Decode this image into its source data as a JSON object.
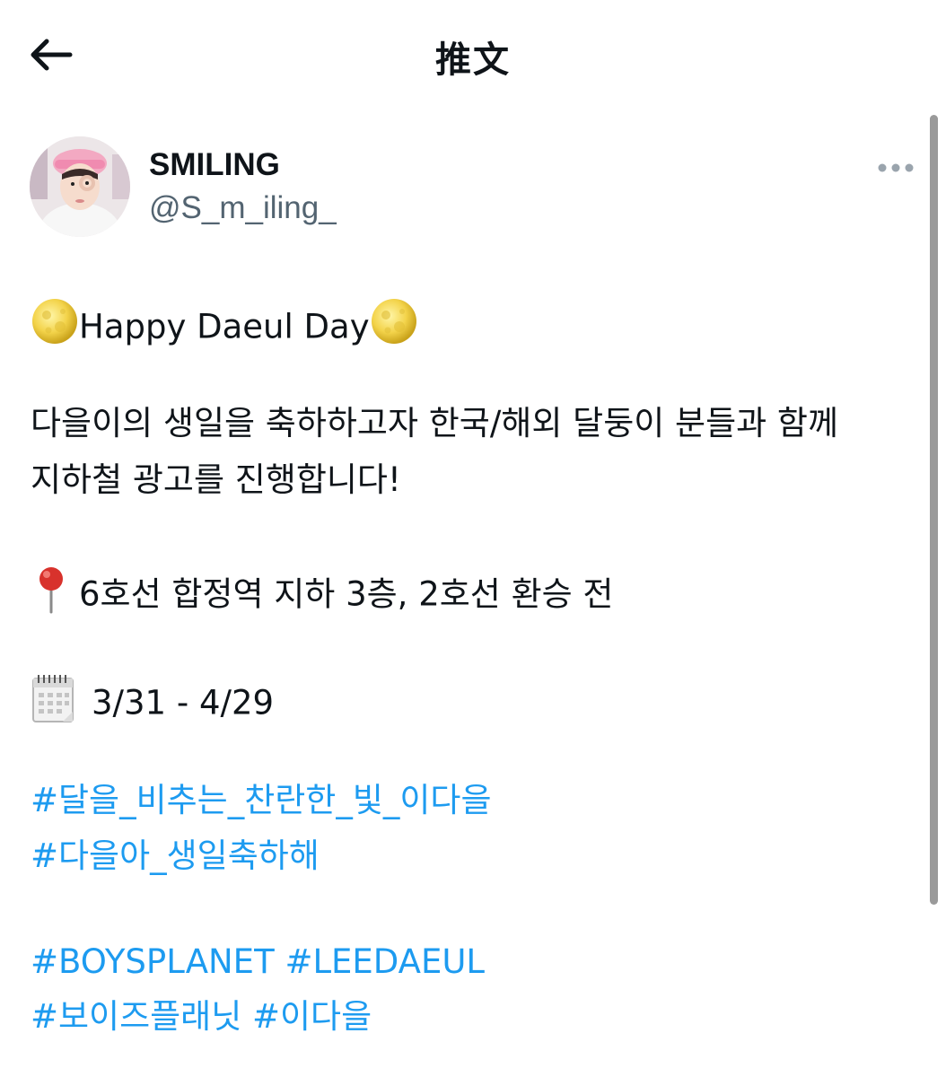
{
  "header": {
    "title": "推文",
    "back_icon": "arrow-left-icon"
  },
  "author": {
    "name": "SMILING",
    "handle": "@S_m_iling_",
    "more_icon": "more-horizontal-icon"
  },
  "tweet": {
    "headline": "Happy Daeul Day",
    "headline_emoji": "full-moon-icon",
    "body_line_1": "다을이의 생일을 축하하고자 한국/해외 달둥이 분들과 함께",
    "body_line_2": "지하철 광고를 진행합니다!",
    "location_emoji": "round-pushpin-icon",
    "location": "6호선 합정역 지하 3층, 2호선 환승 전",
    "calendar_emoji": "spiral-calendar-icon",
    "dates": "3/31 - 4/29",
    "hashtags_group_1": [
      "#달을_비추는_찬란한_빛_이다을",
      "#다을아_생일축하해"
    ],
    "hashtags_group_2_line_1": [
      "#BOYSPLANET",
      "#LEEDAEUL"
    ],
    "hashtags_group_2_line_2": [
      "#보이즈플래닛",
      "#이다을"
    ]
  },
  "colors": {
    "link": "#1d9bf0",
    "text": "#0f1419",
    "secondary": "#536471"
  }
}
